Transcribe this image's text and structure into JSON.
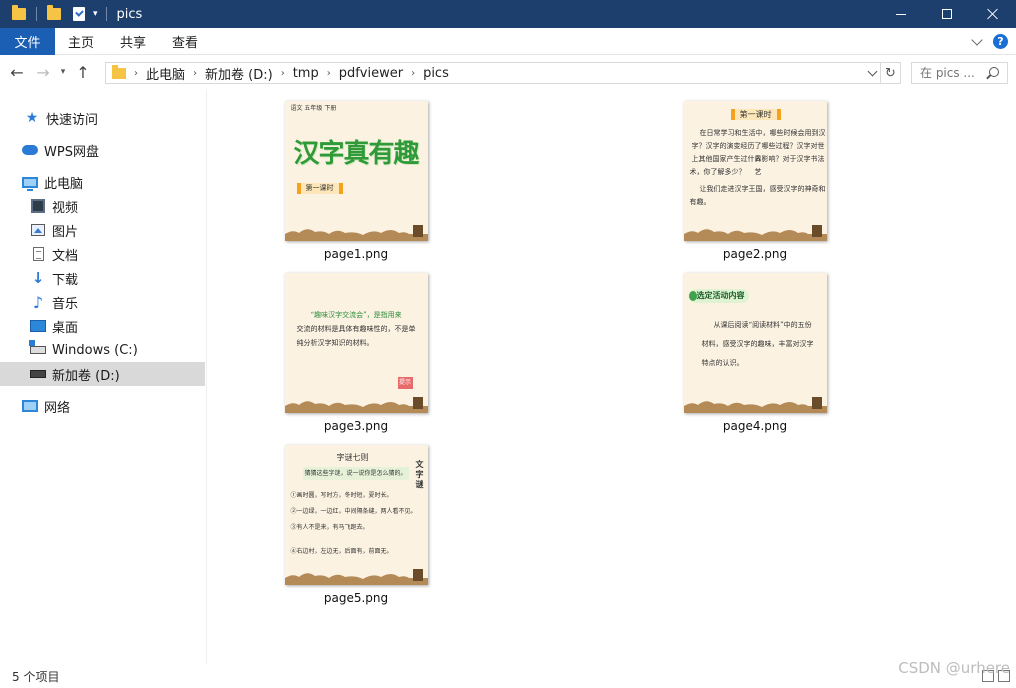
{
  "window": {
    "title": "pics",
    "controls": {
      "minimize": "minimize",
      "maximize": "maximize",
      "close": "close"
    }
  },
  "ribbon": {
    "tabs": [
      {
        "label": "文件"
      },
      {
        "label": "主页"
      },
      {
        "label": "共享"
      },
      {
        "label": "查看"
      }
    ],
    "help": "?"
  },
  "address_bar": {
    "breadcrumbs": [
      "此电脑",
      "新加卷 (D:)",
      "tmp",
      "pdfviewer",
      "pics"
    ]
  },
  "search": {
    "placeholder": "在 pics ..."
  },
  "sidebar": {
    "items": [
      {
        "label": "快速访问",
        "icon": "star-icon"
      },
      {
        "label": "WPS网盘",
        "icon": "cloud-icon"
      },
      {
        "label": "此电脑",
        "icon": "computer-icon"
      },
      {
        "label": "视频",
        "icon": "video-icon"
      },
      {
        "label": "图片",
        "icon": "pictures-icon"
      },
      {
        "label": "文档",
        "icon": "documents-icon"
      },
      {
        "label": "下载",
        "icon": "download-icon"
      },
      {
        "label": "音乐",
        "icon": "music-icon"
      },
      {
        "label": "桌面",
        "icon": "desktop-icon"
      },
      {
        "label": "Windows (C:)",
        "icon": "drive-icon"
      },
      {
        "label": "新加卷 (D:)",
        "icon": "drive-icon",
        "selected": true
      },
      {
        "label": "网络",
        "icon": "network-icon"
      }
    ]
  },
  "files": [
    {
      "name": "page1.png",
      "thumb": {
        "header": "语文 五年级 下册",
        "title": "汉字真有趣",
        "banner": "第一课时"
      }
    },
    {
      "name": "page2.png",
      "thumb": {
        "banner": "第一课时",
        "lines": [
          "在日常学习和生活中，哪些时候会用到汉",
          "字？汉字的演变经历了哪些过程？汉字对世界",
          "上其他国家产生过什么影响？对于汉字书法艺",
          "术，你了解多少？",
          "让我们走进汉字王国，感受汉字的神奇和",
          "有趣。"
        ]
      }
    },
    {
      "name": "page3.png",
      "thumb": {
        "lines": [
          "“趣味汉字交流会”，是指用来",
          "交流的材料是具体有趣味性的，不是单",
          "纯分析汉字知识的材料。"
        ],
        "badge": "提示"
      }
    },
    {
      "name": "page4.png",
      "thumb": {
        "tag": "选定活动内容",
        "lines": [
          "从课后阅读“阅读材料”中的五份",
          "材料，感受汉字的趣味，丰富对汉字",
          "特点的认识。"
        ]
      }
    },
    {
      "name": "page5.png",
      "thumb": {
        "heading": "字谜七则",
        "side": "文字谜",
        "lines": [
          "猜猜这些字谜，说一说你是怎么猜的。",
          "①画时圆，写时方，冬时短，夏时长。",
          "②一边绿，一边红，中间隔条缝，两人看不见。",
          "③有人不是来，有马飞跑去。",
          "④右边村，左边无，后面有，前面无。"
        ]
      }
    }
  ],
  "status": {
    "item_count": "5 个项目"
  },
  "watermark": "CSDN @urhere"
}
